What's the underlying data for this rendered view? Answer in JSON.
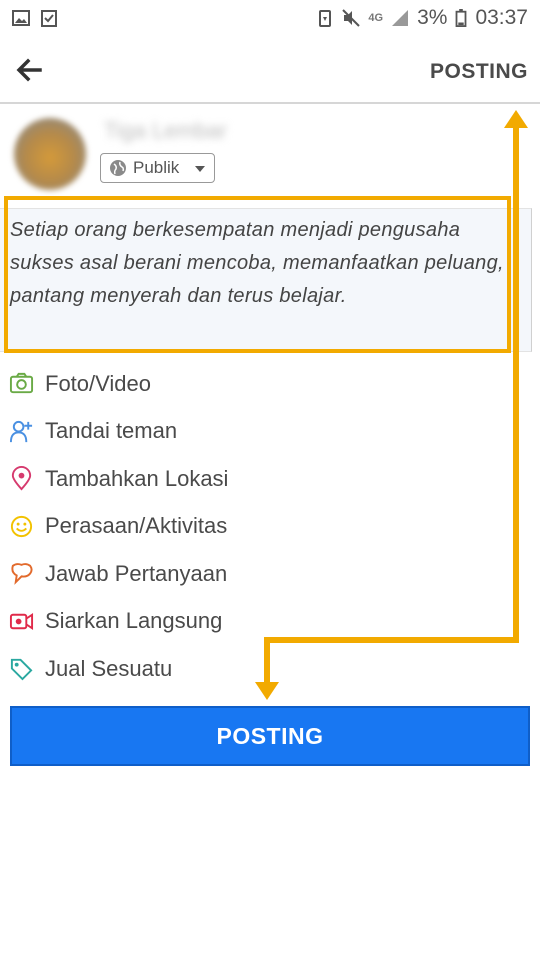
{
  "status_bar": {
    "network": "4G",
    "battery": "3%",
    "time": "03:37"
  },
  "header": {
    "post_label": "POSTING"
  },
  "composer": {
    "user_name": "Tiga Lembar",
    "privacy": "Publik",
    "text": "Setiap orang berkesempatan menjadi pengusaha sukses asal berani mencoba, memanfaatkan peluang, pantang menyerah dan terus belajar."
  },
  "options": [
    {
      "label": "Foto/Video",
      "icon": "camera-icon",
      "color": "#6aaa46"
    },
    {
      "label": "Tandai teman",
      "icon": "tag-friend-icon",
      "color": "#4a90e2"
    },
    {
      "label": "Tambahkan Lokasi",
      "icon": "location-pin-icon",
      "color": "#d63a6e"
    },
    {
      "label": "Perasaan/Aktivitas",
      "icon": "smiley-icon",
      "color": "#f2c200"
    },
    {
      "label": "Jawab Pertanyaan",
      "icon": "speech-bubble-icon",
      "color": "#e26a2c"
    },
    {
      "label": "Siarkan Langsung",
      "icon": "live-video-icon",
      "color": "#e02a4a"
    },
    {
      "label": "Jual Sesuatu",
      "icon": "price-tag-icon",
      "color": "#2aa8a0"
    }
  ],
  "bottom": {
    "post_label": "POSTING"
  },
  "colors": {
    "accent_blue": "#1877f2",
    "highlight_orange": "#f2aa00"
  }
}
